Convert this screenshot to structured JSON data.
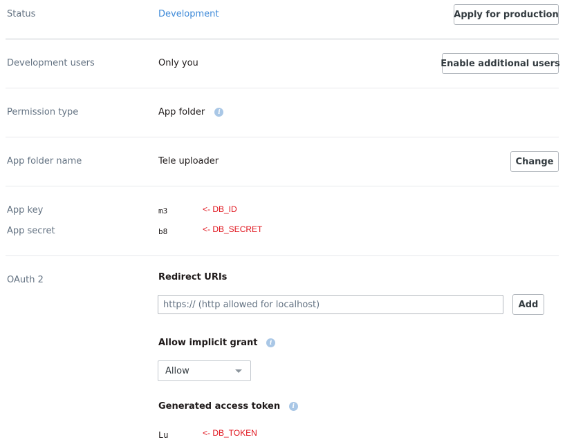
{
  "rows": {
    "status": {
      "label": "Status",
      "value": "Development",
      "button": "Apply for production"
    },
    "dev_users": {
      "label": "Development users",
      "value": "Only you",
      "button": "Enable additional users"
    },
    "permission": {
      "label": "Permission type",
      "value": "App folder"
    },
    "folder_name": {
      "label": "App folder name",
      "value": "Tele uploader",
      "button": "Change"
    },
    "app_key": {
      "label": "App key",
      "value": "m3",
      "annotation": "<- DB_ID"
    },
    "app_secret": {
      "label": "App secret",
      "value": "b8",
      "annotation": "<- DB_SECRET"
    },
    "oauth": {
      "label": "OAuth 2"
    }
  },
  "oauth": {
    "redirect": {
      "heading": "Redirect URIs",
      "placeholder": "https:// (http allowed for localhost)",
      "add_button": "Add"
    },
    "implicit": {
      "heading": "Allow implicit grant",
      "selected": "Allow"
    },
    "token": {
      "heading": "Generated access token",
      "value": "Lu",
      "annotation": "<- DB_TOKEN"
    }
  },
  "icons": {
    "info": "info-icon",
    "dropdown": "chevron-down-icon"
  },
  "colors": {
    "link": "#3d89d8",
    "annotation": "#e0121b",
    "label": "#637282",
    "info": "#a9c7e6"
  }
}
